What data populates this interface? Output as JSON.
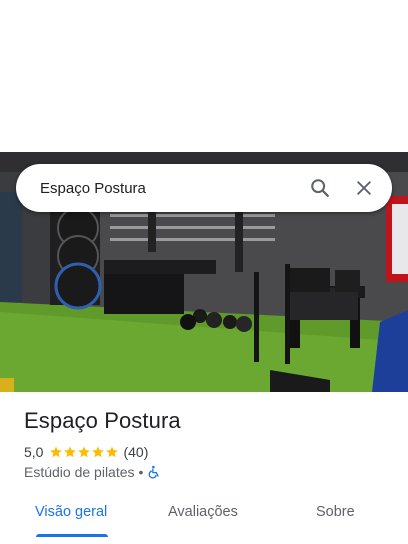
{
  "search": {
    "query": "Espaço Postura"
  },
  "place": {
    "name": "Espaço Postura",
    "rating": "5,0",
    "stars": 5,
    "review_count": "(40)",
    "category": "Estúdio de pilates",
    "separator": "•",
    "accessibility_icon": "wheelchair-icon"
  },
  "tabs": [
    {
      "label": "Visão geral",
      "active": true
    },
    {
      "label": "Avaliações",
      "active": false
    },
    {
      "label": "Sobre",
      "active": false
    }
  ],
  "colors": {
    "accent": "#1a73e8",
    "star": "#fbbc04",
    "turf": "#5f9a2a",
    "wall": "#4a4a4c"
  }
}
